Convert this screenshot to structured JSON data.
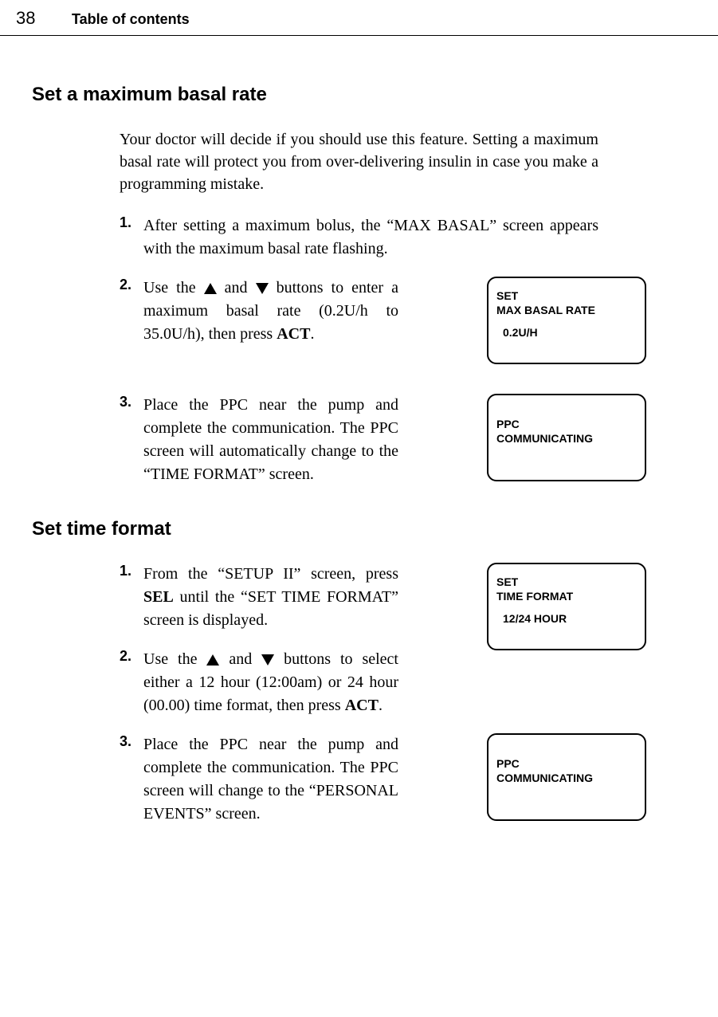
{
  "header": {
    "page": "38",
    "toc": "Table of contents"
  },
  "section1": {
    "title": "Set a maximum basal rate",
    "intro": "Your doctor will decide if you should use this feature. Setting a maximum basal rate will protect you from over-delivering insulin in case you make a programming mistake.",
    "step1_num": "1.",
    "step1_text": "After setting a maximum bolus, the “MAX BASAL” screen appears with the maximum basal rate flashing.",
    "step2_num": "2.",
    "step2_pre": "Use the ",
    "step2_mid": " and ",
    "step2_post": " buttons to enter a maximum basal rate (0.2U/h to 35.0U/h), then press ",
    "step2_bold": "ACT",
    "step2_end": ".",
    "step3_num": "3.",
    "step3_text": "Place the PPC near the pump and complete the communication. The PPC screen will automatically change to the “TIME FORMAT” screen.",
    "screen1_l1": "SET",
    "screen1_l2": "MAX BASAL RATE",
    "screen1_val": "0.2U/H",
    "screen2_l1": "PPC",
    "screen2_l2": "COMMUNICATING"
  },
  "section2": {
    "title": "Set time format",
    "step1_num": "1.",
    "step1_pre": "From the “SETUP II” screen, press ",
    "step1_bold": "SEL",
    "step1_post": " until the “SET TIME FORMAT” screen is displayed.",
    "step2_num": "2.",
    "step2_pre": "Use the ",
    "step2_mid": " and ",
    "step2_post": " buttons to select either a 12 hour (12:00am) or 24 hour (00.00) time format, then press ",
    "step2_bold": "ACT",
    "step2_end": ".",
    "step3_num": "3.",
    "step3_text": "Place the PPC near the pump and complete the communication. The PPC screen will change to the “PERSONAL EVENTS” screen.",
    "screen1_l1": "SET",
    "screen1_l2": "TIME FORMAT",
    "screen1_val": "12/24 HOUR",
    "screen2_l1": "PPC",
    "screen2_l2": "COMMUNICATING"
  }
}
